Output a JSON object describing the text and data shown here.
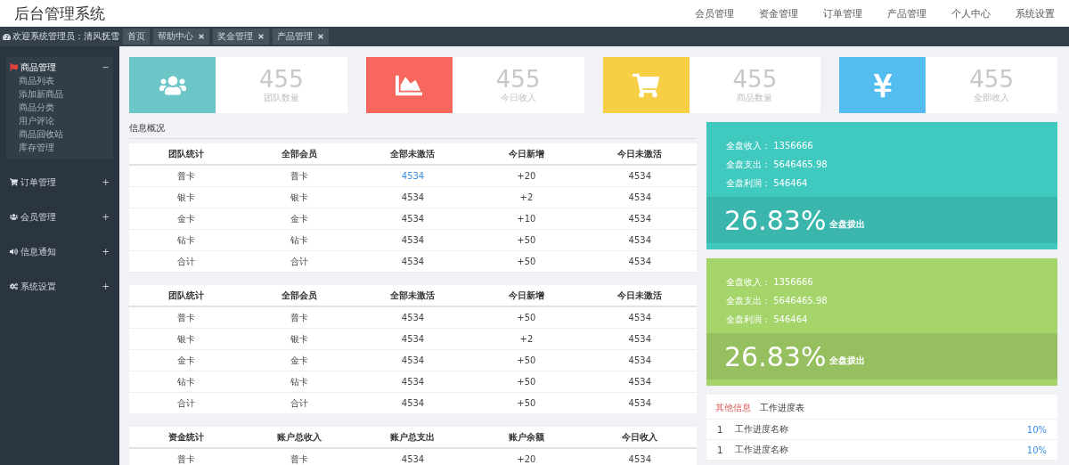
{
  "header": {
    "title": "后台管理系统",
    "nav": [
      "会员管理",
      "资金管理",
      "订单管理",
      "产品管理",
      "个人中心",
      "系统设置"
    ]
  },
  "welcome": {
    "label": "欢迎系统管理员：",
    "user": "清风抚雪"
  },
  "tabs": [
    {
      "label": "首页",
      "closable": false
    },
    {
      "label": "帮助中心",
      "closable": true
    },
    {
      "label": "奖金管理",
      "closable": true
    },
    {
      "label": "产品管理",
      "closable": true
    }
  ],
  "sidebar": [
    {
      "label": "商品管理",
      "expanded": true,
      "toggle": "−",
      "children": [
        "商品列表",
        "添加新商品",
        "商品分类",
        "用户评论",
        "商品回收站",
        "库存管理"
      ]
    },
    {
      "label": "订单管理",
      "expanded": false,
      "toggle": "+"
    },
    {
      "label": "会员管理",
      "expanded": false,
      "toggle": "+"
    },
    {
      "label": "信息通知",
      "expanded": false,
      "toggle": "+"
    },
    {
      "label": "系统设置",
      "expanded": false,
      "toggle": "+"
    }
  ],
  "stats": [
    {
      "value": "455",
      "label": "团队数量",
      "color": "#6cc6c7"
    },
    {
      "value": "455",
      "label": "今日收入",
      "color": "#f7675d"
    },
    {
      "value": "455",
      "label": "商品数量",
      "color": "#f6cf45"
    },
    {
      "value": "455",
      "label": "全部收入",
      "color": "#53bdf0"
    }
  ],
  "section_title": "信息概况",
  "tables": [
    {
      "columns": [
        "团队统计",
        "全部会员",
        "全部未激活",
        "今日新增",
        "今日未激活"
      ],
      "rows": [
        {
          "cells": [
            "普卡",
            "普卡",
            "4534",
            "+20",
            "4534"
          ],
          "linked": true
        },
        {
          "cells": [
            "银卡",
            "银卡",
            "4534",
            "+2",
            "4534"
          ]
        },
        {
          "cells": [
            "金卡",
            "金卡",
            "4534",
            "+10",
            "4534"
          ]
        },
        {
          "cells": [
            "钻卡",
            "钻卡",
            "4534",
            "+50",
            "4534"
          ]
        },
        {
          "cells": [
            "合计",
            "合计",
            "4534",
            "+50",
            "4534"
          ]
        }
      ]
    },
    {
      "columns": [
        "团队统计",
        "全部会员",
        "全部未激活",
        "今日新增",
        "今日未激活"
      ],
      "rows": [
        {
          "cells": [
            "普卡",
            "普卡",
            "4534",
            "+50",
            "4534"
          ]
        },
        {
          "cells": [
            "银卡",
            "银卡",
            "4534",
            "+2",
            "4534"
          ]
        },
        {
          "cells": [
            "金卡",
            "金卡",
            "4534",
            "+50",
            "4534"
          ]
        },
        {
          "cells": [
            "钻卡",
            "钻卡",
            "4534",
            "+50",
            "4534"
          ]
        },
        {
          "cells": [
            "合计",
            "合计",
            "4534",
            "+50",
            "4534"
          ]
        }
      ]
    },
    {
      "columns": [
        "资金统计",
        "账户总收入",
        "账户总支出",
        "账户余额",
        "今日收入"
      ],
      "rows": [
        {
          "cells": [
            "普卡",
            "普卡",
            "4534",
            "+20",
            "4534"
          ]
        }
      ]
    }
  ],
  "summaries": [
    {
      "color": "#40c9bf",
      "lines": [
        {
          "label": "全盘收入：",
          "value": "1356666"
        },
        {
          "label": "全盘支出：",
          "value": "5646465.98"
        },
        {
          "label": "全盘利润：",
          "value": "546464"
        }
      ],
      "percent": "26.83%",
      "percent_label": "全盘拨出"
    },
    {
      "color": "#a5d46a",
      "lines": [
        {
          "label": "全盘收入：",
          "value": "1356666"
        },
        {
          "label": "全盘支出：",
          "value": "5646465.98"
        },
        {
          "label": "全盘利润：",
          "value": "546464"
        }
      ],
      "percent": "26.83%",
      "percent_label": "全盘拨出"
    }
  ],
  "other": {
    "tabs": [
      {
        "label": "其他信息",
        "selected": true
      },
      {
        "label": "工作进度表",
        "selected": false
      }
    ],
    "rows": [
      {
        "index": "1",
        "name": "工作进度名称",
        "progress": "10%"
      },
      {
        "index": "1",
        "name": "工作进度名称",
        "progress": "10%"
      }
    ]
  }
}
